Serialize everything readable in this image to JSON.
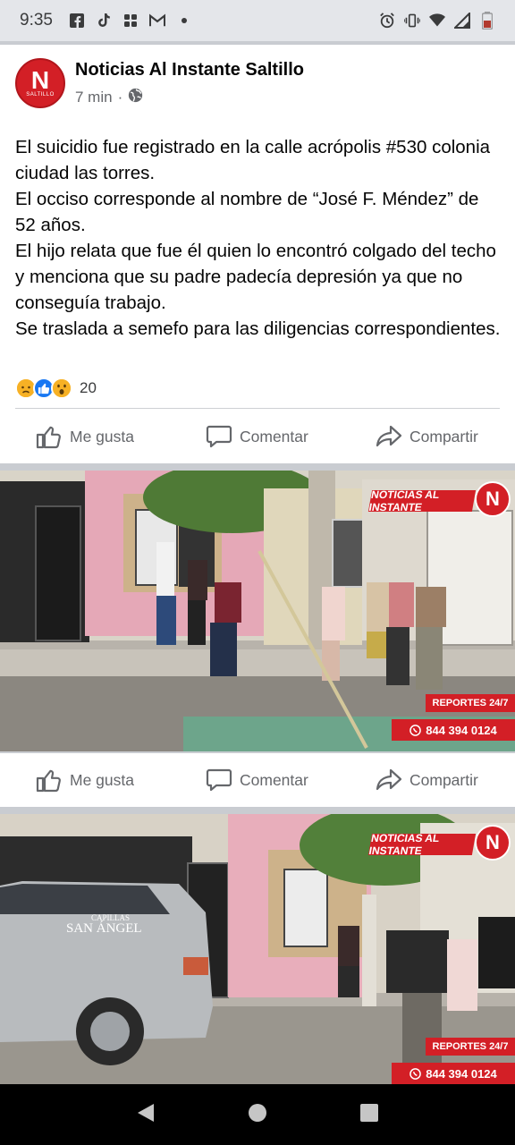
{
  "status_bar": {
    "time": "9:35",
    "left_icons": [
      "facebook-icon",
      "tiktok-icon",
      "grid-icon",
      "gmail-icon",
      "dot-icon"
    ],
    "right_icons": [
      "alarm-icon",
      "vibrate-icon",
      "wifi-icon",
      "signal-icon",
      "battery-icon"
    ]
  },
  "post": {
    "page_name": "Noticias Al Instante Saltillo",
    "avatar_letter": "N",
    "avatar_sub": "SALTILLO",
    "time": "7 min",
    "separator": "·",
    "privacy_icon": "globe-icon",
    "text_lines": [
      "El suicidio fue registrado en la calle acrópolis #530 colonia ciudad las torres.",
      "El occiso corresponde al nombre de “José F. Méndez” de 52 años.",
      "El hijo relata que fue él quien lo encontró colgado del techo y menciona que su padre padecía depresión ya que no conseguía trabajo.",
      "Se traslada a semefo para las diligencias correspondientes."
    ],
    "reactions": [
      "sad",
      "like",
      "wow"
    ],
    "reaction_count": "20"
  },
  "actions": {
    "like_label": "Me gusta",
    "comment_label": "Comentar",
    "share_label": "Compartir"
  },
  "photos": [
    {
      "watermark": "NOTICIAS AL INSTANTE",
      "badge_letter": "N",
      "reports": "REPORTES 24/7",
      "phone": "844 394 0124"
    },
    {
      "watermark": "NOTICIAS AL INSTANTE",
      "badge_letter": "N",
      "reports": "REPORTES 24/7",
      "phone": "844 394 0124",
      "van_text_1": "CAPILLAS",
      "van_text_2": "SAN ÁNGEL"
    }
  ],
  "nav": [
    "back-icon",
    "home-icon",
    "recents-icon"
  ]
}
